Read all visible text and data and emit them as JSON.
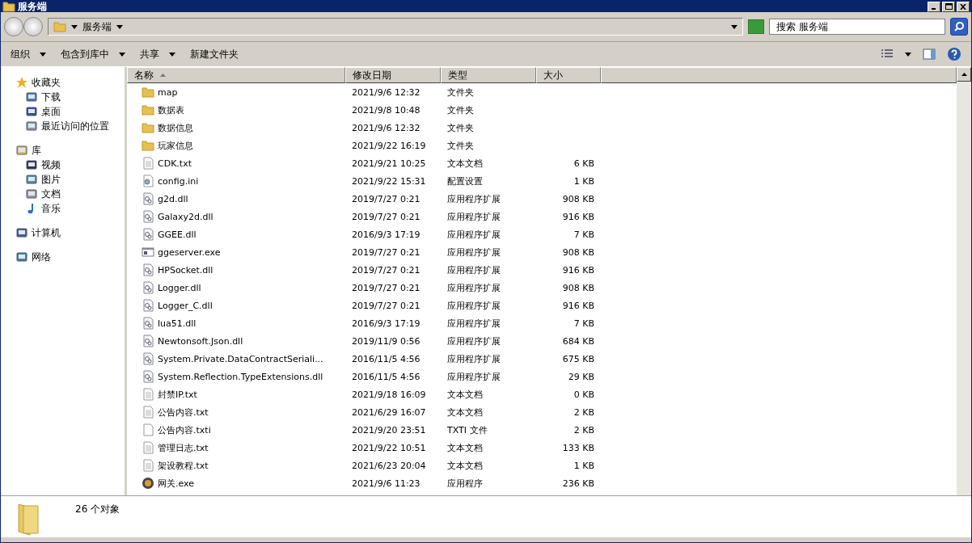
{
  "window": {
    "title": "服务端"
  },
  "address_bar": {
    "path": "服务端",
    "search_placeholder": "搜索 服务端"
  },
  "toolbar": {
    "items": [
      {
        "label": "组织",
        "dropdown": true
      },
      {
        "label": "包含到库中",
        "dropdown": true
      },
      {
        "label": "共享",
        "dropdown": true
      },
      {
        "label": "新建文件夹",
        "dropdown": false
      }
    ]
  },
  "sidebar": {
    "items": [
      {
        "label": "收藏夹",
        "kind": "favorites",
        "children": [
          {
            "label": "下载",
            "kind": "download"
          },
          {
            "label": "桌面",
            "kind": "desktop"
          },
          {
            "label": "最近访问的位置",
            "kind": "recent"
          }
        ]
      },
      {
        "label": "库",
        "kind": "library",
        "children": [
          {
            "label": "视频",
            "kind": "video"
          },
          {
            "label": "图片",
            "kind": "picture"
          },
          {
            "label": "文档",
            "kind": "document"
          },
          {
            "label": "音乐",
            "kind": "music"
          }
        ]
      },
      {
        "label": "计算机",
        "kind": "computer"
      },
      {
        "label": "网络",
        "kind": "network"
      }
    ]
  },
  "table": {
    "columns": [
      "名称",
      "修改日期",
      "类型",
      "大小"
    ],
    "rows": [
      {
        "kind": "folder",
        "name": "map",
        "date": "2021/9/6 12:32",
        "type": "文件夹"
      },
      {
        "kind": "folder",
        "name": "数据表",
        "date": "2021/9/8 10:48",
        "type": "文件夹"
      },
      {
        "kind": "folder",
        "name": "数据信息",
        "date": "2021/9/6 12:32",
        "type": "文件夹"
      },
      {
        "kind": "folder",
        "name": "玩家信息",
        "date": "2021/9/22 16:19",
        "type": "文件夹"
      },
      {
        "kind": "text",
        "name": "CDK.txt",
        "date": "2021/9/21 10:25",
        "type": "文本文档",
        "size": "6 KB"
      },
      {
        "kind": "config",
        "name": "config.ini",
        "date": "2021/9/22 15:31",
        "type": "配置设置",
        "size": "1 KB"
      },
      {
        "kind": "dll",
        "name": "g2d.dll",
        "date": "2019/7/27 0:21",
        "type": "应用程序扩展",
        "size": "908 KB"
      },
      {
        "kind": "dll",
        "name": "Galaxy2d.dll",
        "date": "2019/7/27 0:21",
        "type": "应用程序扩展",
        "size": "916 KB"
      },
      {
        "kind": "dll",
        "name": "GGEE.dll",
        "date": "2016/9/3 17:19",
        "type": "应用程序扩展",
        "size": "7 KB"
      },
      {
        "kind": "exe",
        "name": "ggeserver.exe",
        "date": "2019/7/27 0:21",
        "type": "应用程序扩展",
        "size": "908 KB"
      },
      {
        "kind": "dll",
        "name": "HPSocket.dll",
        "date": "2019/7/27 0:21",
        "type": "应用程序扩展",
        "size": "916 KB"
      },
      {
        "kind": "dll",
        "name": "Logger.dll",
        "date": "2019/7/27 0:21",
        "type": "应用程序扩展",
        "size": "908 KB"
      },
      {
        "kind": "dll",
        "name": "Logger_C.dll",
        "date": "2019/7/27 0:21",
        "type": "应用程序扩展",
        "size": "916 KB"
      },
      {
        "kind": "dll",
        "name": "lua51.dll",
        "date": "2016/9/3 17:19",
        "type": "应用程序扩展",
        "size": "7 KB"
      },
      {
        "kind": "dll",
        "name": "Newtonsoft.Json.dll",
        "date": "2019/11/9 0:56",
        "type": "应用程序扩展",
        "size": "684 KB"
      },
      {
        "kind": "dll",
        "name": "System.Private.DataContractSeriali...",
        "date": "2016/11/5 4:56",
        "type": "应用程序扩展",
        "size": "675 KB"
      },
      {
        "kind": "dll",
        "name": "System.Reflection.TypeExtensions.dll",
        "date": "2016/11/5 4:56",
        "type": "应用程序扩展",
        "size": "29 KB"
      },
      {
        "kind": "text",
        "name": "封禁IP.txt",
        "date": "2021/9/18 16:09",
        "type": "文本文档",
        "size": "0 KB"
      },
      {
        "kind": "text",
        "name": "公告内容.txt",
        "date": "2021/6/29 16:07",
        "type": "文本文档",
        "size": "2 KB"
      },
      {
        "kind": "blank",
        "name": "公告内容.txti",
        "date": "2021/9/20 23:51",
        "type": "TXTI 文件",
        "size": "2 KB"
      },
      {
        "kind": "text",
        "name": "管理日志.txt",
        "date": "2021/9/22 10:51",
        "type": "文本文档",
        "size": "133 KB"
      },
      {
        "kind": "text",
        "name": "架设教程.txt",
        "date": "2021/6/23 20:04",
        "type": "文本文档",
        "size": "1 KB"
      },
      {
        "kind": "app",
        "name": "网关.exe",
        "date": "2021/9/6 11:23",
        "type": "应用程序",
        "size": "236 KB"
      }
    ]
  },
  "status_bar": {
    "text": "26 个对象"
  }
}
